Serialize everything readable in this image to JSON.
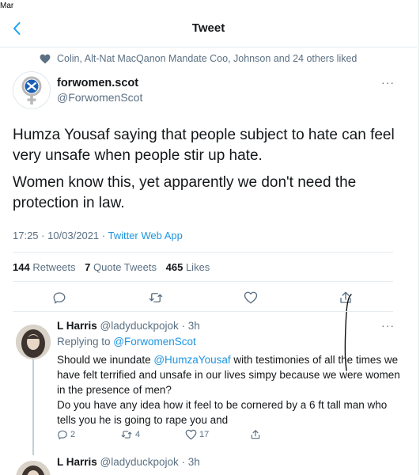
{
  "status_bar": {
    "time": "Mar"
  },
  "header": {
    "title": "Tweet"
  },
  "liked_by": "Colin, Alt-Nat MacQanon Mandate Coo, Johnson and 24 others liked",
  "tweet": {
    "author_name": "forwomen.scot",
    "author_handle": "@ForwomenScot",
    "more": "···",
    "text_p1": "Humza Yousaf saying that people subject to hate can feel very unsafe when people stir up hate.",
    "text_p2": "Women know this, yet apparently we don't need the protection in law.",
    "time": "17:25 · 10/03/2021 · ",
    "source": "Twitter Web App",
    "retweets_count": "144",
    "retweets_label": "Retweets",
    "quotes_count": "7",
    "quotes_label": "Quote Tweets",
    "likes_count": "465",
    "likes_label": "Likes"
  },
  "replies": [
    {
      "name": "L Harris",
      "handle_time": "@ladyduckpojok · 3h",
      "replying_label": "Replying to ",
      "replying_to": "@ForwomenScot",
      "text_a": "Should we inundate ",
      "mention": "@HumzaYousaf",
      "text_b": "  with testimonies of all the times we have felt terrified and unsafe in our lives simpy because we were women in the presence of men?",
      "text_c": "Do you have any idea how it feel to be cornered by a 6 ft tall man who tells you he is going to rape you and",
      "reply_count": "2",
      "retweet_count": "4",
      "like_count": "17",
      "more": "···"
    },
    {
      "name": "L Harris",
      "handle_time": "@ladyduckpojok · 3h"
    }
  ],
  "colors": {
    "accent": "#1b95e0",
    "muted": "#5b7083",
    "text": "#14171a",
    "divider": "#e6ecf0"
  }
}
